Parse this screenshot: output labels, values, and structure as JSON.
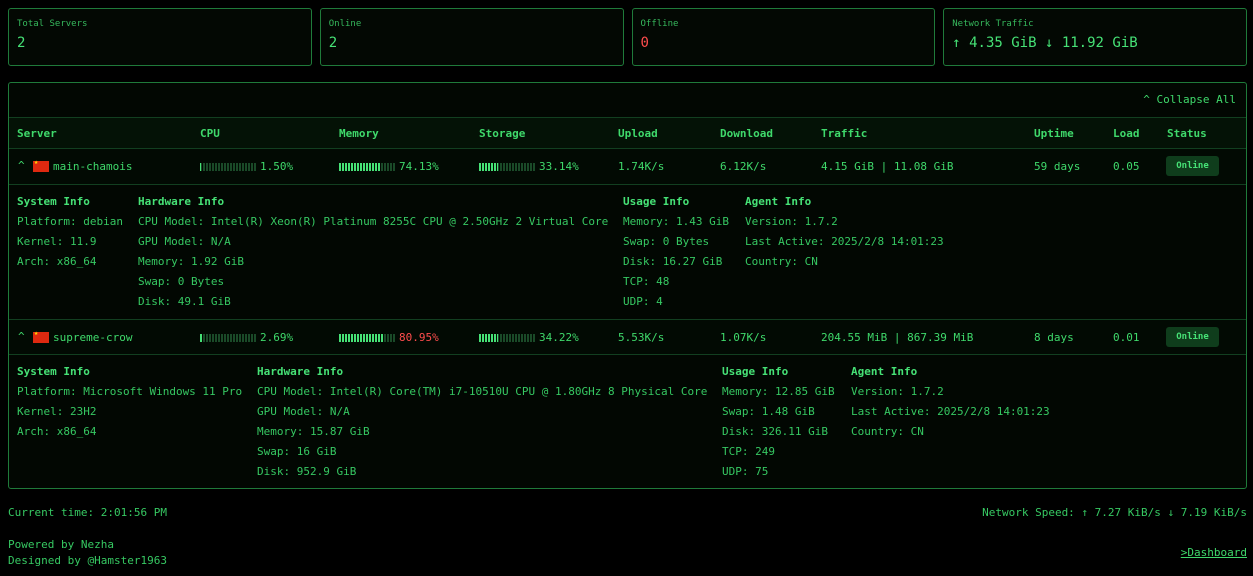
{
  "cards": [
    {
      "label": "Total Servers",
      "value": "2"
    },
    {
      "label": "Online",
      "value": "2"
    },
    {
      "label": "Offline",
      "value": "0"
    },
    {
      "label": "Network Traffic",
      "value": "↑ 4.35 GiB ↓ 11.92 GiB"
    }
  ],
  "collapse_label": "^ Collapse All",
  "columns": [
    "Server",
    "CPU",
    "Memory",
    "Storage",
    "Upload",
    "Download",
    "Traffic",
    "Uptime",
    "Load",
    "Status"
  ],
  "servers": [
    {
      "caret": "^",
      "name": "main-chamois",
      "cpu": "1.50%",
      "cpu_frac": 0.015,
      "memory": "74.13%",
      "memory_frac": 0.7413,
      "storage": "33.14%",
      "storage_frac": 0.3314,
      "upload": "1.74K/s",
      "download": "6.12K/s",
      "traffic": "4.15 GiB | 11.08 GiB",
      "uptime": "59 days",
      "load": "0.05",
      "status": "Online",
      "system": {
        "title": "System Info",
        "lines": [
          "Platform: debian",
          "Kernel: 11.9",
          "Arch: x86_64"
        ]
      },
      "hardware": {
        "title": "Hardware Info",
        "lines": [
          "CPU Model: Intel(R) Xeon(R) Platinum 8255C CPU @ 2.50GHz 2 Virtual Core",
          "GPU Model: N/A",
          "Memory: 1.92 GiB",
          "Swap: 0 Bytes",
          "Disk: 49.1 GiB"
        ]
      },
      "usage": {
        "title": "Usage Info",
        "lines": [
          "Memory: 1.43 GiB",
          "Swap: 0 Bytes",
          "Disk: 16.27 GiB",
          "TCP: 48",
          "UDP: 4"
        ]
      },
      "agent": {
        "title": "Agent Info",
        "lines": [
          "Version: 1.7.2",
          "Last Active: 2025/2/8 14:01:23",
          "Country: CN"
        ]
      }
    },
    {
      "caret": "^",
      "name": "supreme-crow",
      "cpu": "2.69%",
      "cpu_frac": 0.0269,
      "memory": "80.95%",
      "memory_frac": 0.8095,
      "storage": "34.22%",
      "storage_frac": 0.3422,
      "upload": "5.53K/s",
      "download": "1.07K/s",
      "traffic": "204.55 MiB | 867.39 MiB",
      "uptime": "8 days",
      "load": "0.01",
      "status": "Online",
      "system": {
        "title": "System Info",
        "lines": [
          "Platform: Microsoft Windows 11 Pro",
          "Kernel: 23H2",
          "Arch: x86_64"
        ]
      },
      "hardware": {
        "title": "Hardware Info",
        "lines": [
          "CPU Model: Intel(R) Core(TM) i7-10510U CPU @ 1.80GHz 8 Physical Core",
          "GPU Model: N/A",
          "Memory: 15.87 GiB",
          "Swap: 16 GiB",
          "Disk: 952.9 GiB"
        ]
      },
      "usage": {
        "title": "Usage Info",
        "lines": [
          "Memory: 12.85 GiB",
          "Swap: 1.48 GiB",
          "Disk: 326.11 GiB",
          "TCP: 249",
          "UDP: 75"
        ]
      },
      "agent": {
        "title": "Agent Info",
        "lines": [
          "Version: 1.7.2",
          "Last Active: 2025/2/8 14:01:23",
          "Country: CN"
        ]
      }
    }
  ],
  "footer": {
    "current_time": "Current time: 2:01:56 PM",
    "network_speed": "Network Speed: ↑ 7.27 KiB/s ↓ 7.19 KiB/s",
    "powered_by": "Powered by Nezha",
    "designed_by": "Designed by @Hamster1963",
    "dashboard_link": ">Dashboard"
  },
  "colors": {
    "accent": "#3fd96b",
    "danger": "#ff4d4d",
    "background": "#000000",
    "border": "#1f7a3a"
  }
}
